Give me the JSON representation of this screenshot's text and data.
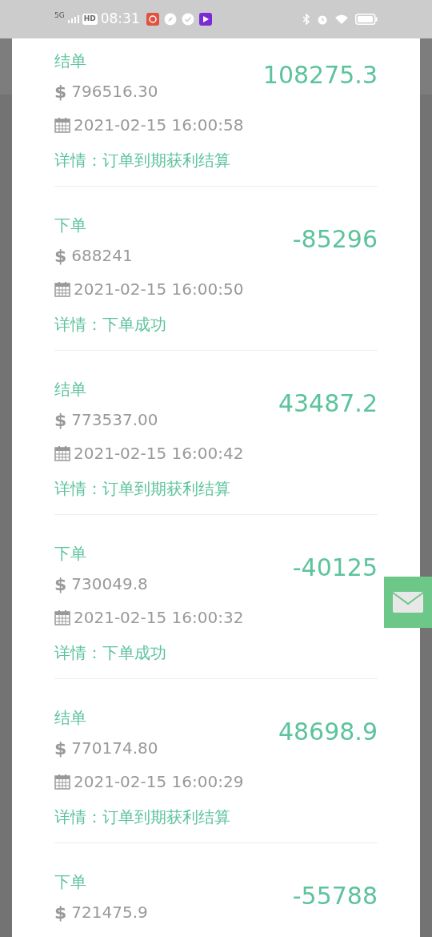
{
  "status_bar": {
    "network": "5G",
    "hd": "HD",
    "time": "08:31"
  },
  "records": [
    {
      "type": "结单",
      "currency": "$",
      "value": "796516.30",
      "amount": "108275.3",
      "time": "2021-02-15 16:00:58",
      "detail": "详情：订单到期获利结算"
    },
    {
      "type": "下单",
      "currency": "$",
      "value": "688241",
      "amount": "-85296",
      "time": "2021-02-15 16:00:50",
      "detail": "详情：下单成功"
    },
    {
      "type": "结单",
      "currency": "$",
      "value": "773537.00",
      "amount": "43487.2",
      "time": "2021-02-15 16:00:42",
      "detail": "详情：订单到期获利结算"
    },
    {
      "type": "下单",
      "currency": "$",
      "value": "730049.8",
      "amount": "-40125",
      "time": "2021-02-15 16:00:32",
      "detail": "详情：下单成功"
    },
    {
      "type": "结单",
      "currency": "$",
      "value": "770174.80",
      "amount": "48698.9",
      "time": "2021-02-15 16:00:29",
      "detail": "详情：订单到期获利结算"
    },
    {
      "type": "下单",
      "currency": "$",
      "value": "721475.9",
      "amount": "-55788"
    }
  ]
}
